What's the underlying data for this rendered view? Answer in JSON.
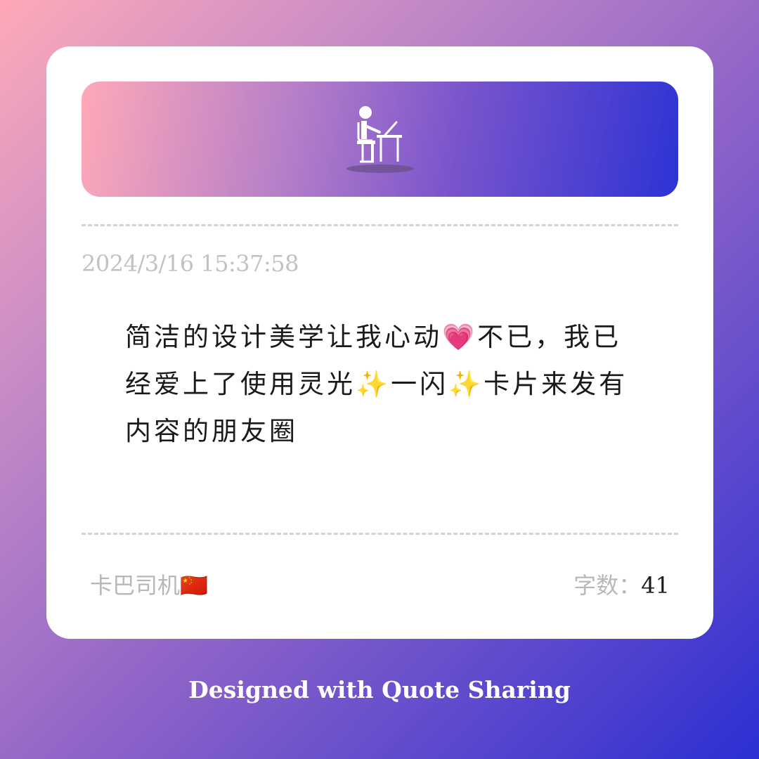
{
  "card": {
    "banner_icon": "person-at-desk-icon",
    "timestamp": "2024/3/16 15:37:58",
    "quote": "简洁的设计美学让我心动💗不已，我已经爱上了使用灵光✨一闪✨卡片来发有内容的朋友圈",
    "author": "卡巴司机🇨🇳",
    "wordcount_label": "字数：",
    "wordcount_value": "41"
  },
  "footer": {
    "text": "Designed with Quote Sharing"
  },
  "colors": {
    "gradient_start": "#ffa9b8",
    "gradient_end": "#2c2fd2",
    "card_bg": "#ffffff",
    "muted_text": "#b8b8b8",
    "body_text": "#1a1a1a"
  }
}
